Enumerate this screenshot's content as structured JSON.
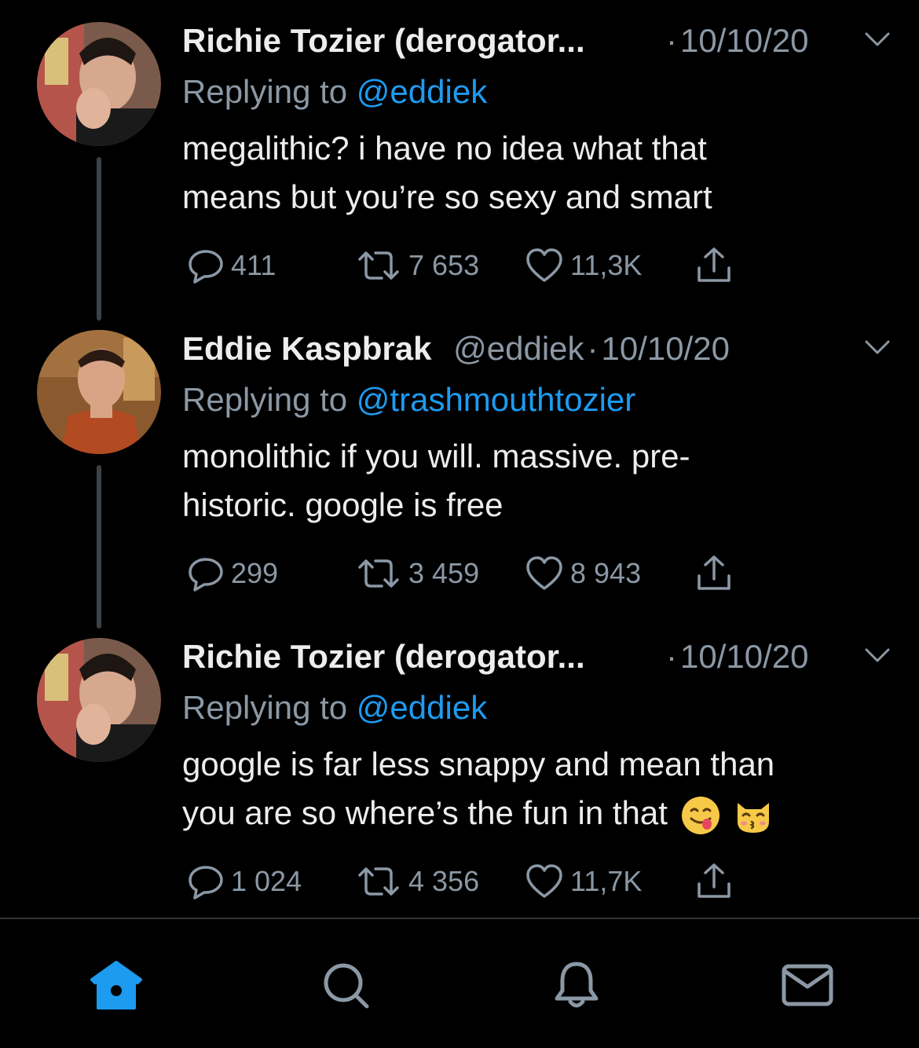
{
  "colors": {
    "background": "#000000",
    "accent": "#1d9bf0",
    "muted": "#8b98a5",
    "text": "#ededed"
  },
  "tweets": [
    {
      "name": "Richie Tozier (derogator...",
      "handle": "",
      "dot": "·",
      "date": "10/10/20",
      "reply_prefix": "Replying to",
      "reply_to": "@eddiek",
      "text_lines": [
        "megalithic? i have no idea what that",
        "means but you’re so sexy and smart"
      ],
      "emojis": [],
      "replies": "411",
      "retweets": "7 653",
      "likes": "11,3K",
      "avatar": "richie-avatar"
    },
    {
      "name": "Eddie Kaspbrak",
      "handle": "@eddiek",
      "dot": "·",
      "date": "10/10/20",
      "reply_prefix": "Replying to",
      "reply_to": "@trashmouthtozier",
      "text_lines": [
        "monolithic if you will. massive. pre-",
        "historic. google is free"
      ],
      "emojis": [],
      "replies": "299",
      "retweets": "3 459",
      "likes": "8 943",
      "avatar": "eddie-avatar"
    },
    {
      "name": "Richie Tozier (derogator...",
      "handle": "",
      "dot": "·",
      "date": "10/10/20",
      "reply_prefix": "Replying to",
      "reply_to": "@eddiek",
      "text_lines": [
        "google is far less snappy and mean than",
        "you are so where’s the fun in that"
      ],
      "emojis": [
        "face-savoring-food-emoji",
        "kissing-cat-emoji"
      ],
      "replies": "1 024",
      "retweets": "4 356",
      "likes": "11,7K",
      "avatar": "richie-avatar"
    }
  ],
  "tabbar": {
    "icons": [
      "home-icon",
      "search-icon",
      "notifications-icon",
      "messages-icon"
    ],
    "active": "home-icon"
  }
}
